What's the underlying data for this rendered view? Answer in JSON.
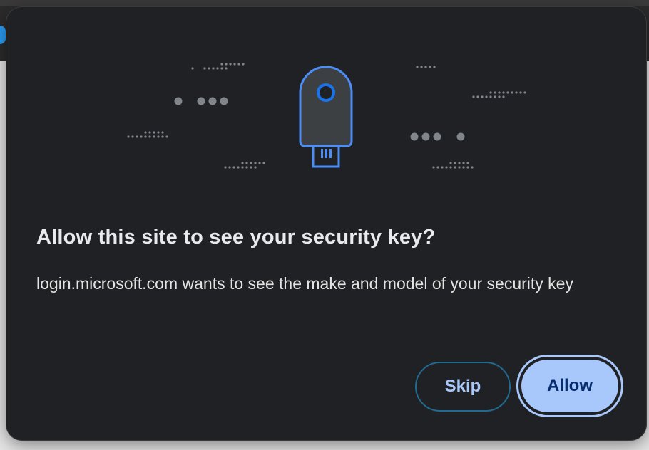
{
  "dialog": {
    "title": "Allow this site to see your security key?",
    "message": "login.microsoft.com wants to see the make and model of your security key",
    "skip_label": "Skip",
    "allow_label": "Allow"
  },
  "illustration": {
    "icon": "security-key-icon",
    "accent_color": "#4c8df6"
  },
  "colors": {
    "dialog_background": "#202124",
    "primary_button": "#a8c7fa",
    "primary_button_text": "#062e6f",
    "secondary_button_border": "#1f6b91",
    "secondary_button_text": "#a8c7fa"
  }
}
